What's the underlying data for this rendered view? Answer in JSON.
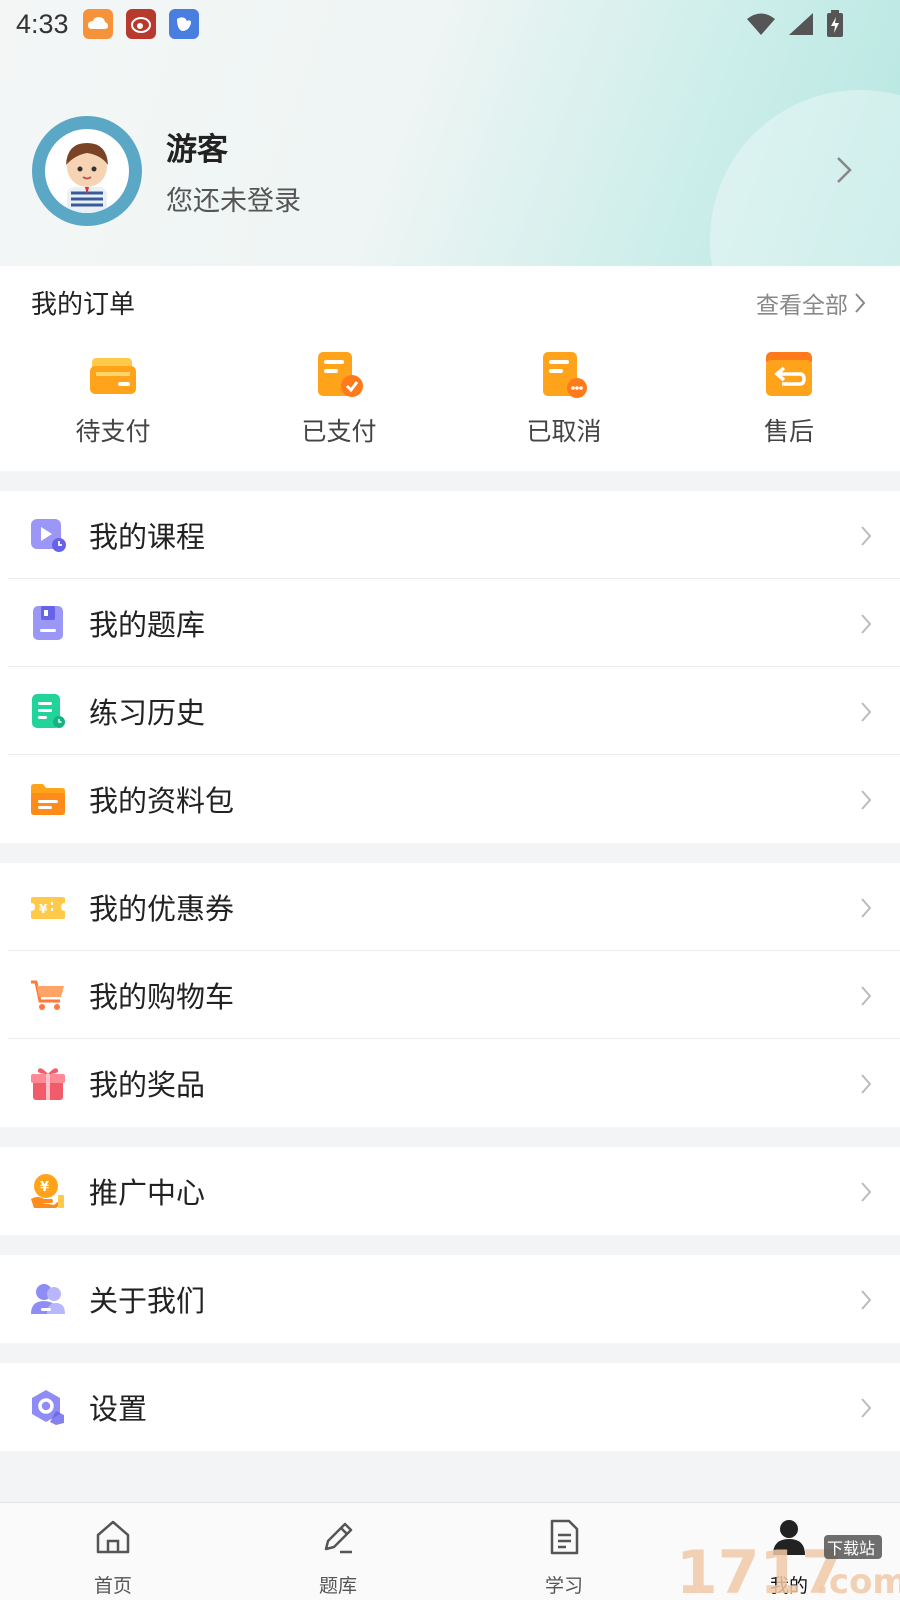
{
  "status_bar": {
    "time": "4:33",
    "apps": [
      {
        "icon": "weather-app-icon",
        "color": "#f5923a"
      },
      {
        "icon": "weibo-app-icon",
        "color": "#c0392b"
      },
      {
        "icon": "bird-app-icon",
        "color": "#4a7de0"
      }
    ],
    "icons": [
      "wifi-icon",
      "signal-icon",
      "battery-charging-icon"
    ]
  },
  "profile": {
    "name": "游客",
    "subtitle": "您还未登录"
  },
  "orders": {
    "title": "我的订单",
    "view_all": "查看全部",
    "items": [
      {
        "label": "待支付",
        "icon": "wallet-icon"
      },
      {
        "label": "已支付",
        "icon": "paid-document-icon"
      },
      {
        "label": "已取消",
        "icon": "cancelled-document-icon"
      },
      {
        "label": "售后",
        "icon": "return-box-icon"
      }
    ]
  },
  "menu_groups": [
    {
      "items": [
        {
          "label": "我的课程",
          "icon": "course-video-icon"
        },
        {
          "label": "我的题库",
          "icon": "question-bank-icon"
        },
        {
          "label": "练习历史",
          "icon": "practice-history-icon"
        },
        {
          "label": "我的资料包",
          "icon": "folder-icon"
        }
      ]
    },
    {
      "items": [
        {
          "label": "我的优惠券",
          "icon": "coupon-icon"
        },
        {
          "label": "我的购物车",
          "icon": "shopping-cart-icon"
        },
        {
          "label": "我的奖品",
          "icon": "gift-icon"
        }
      ]
    },
    {
      "items": [
        {
          "label": "推广中心",
          "icon": "promotion-coin-icon"
        }
      ]
    },
    {
      "items": [
        {
          "label": "关于我们",
          "icon": "about-users-icon"
        }
      ]
    },
    {
      "items": [
        {
          "label": "设置",
          "icon": "settings-hexagon-icon"
        }
      ]
    }
  ],
  "tabbar": {
    "tabs": [
      {
        "label": "首页",
        "icon": "home-icon"
      },
      {
        "label": "题库",
        "icon": "pencil-icon"
      },
      {
        "label": "学习",
        "icon": "document-icon"
      },
      {
        "label": "我的",
        "icon": "profile-icon",
        "active": true
      }
    ]
  },
  "watermark": {
    "text": "17173.com 下载站"
  },
  "colors": {
    "accent_orange": "#ffa31a",
    "accent_purple": "#8f8df5",
    "accent_green": "#22d49a",
    "accent_red": "#f25c6a",
    "header_teal": "#b6e6e1"
  }
}
